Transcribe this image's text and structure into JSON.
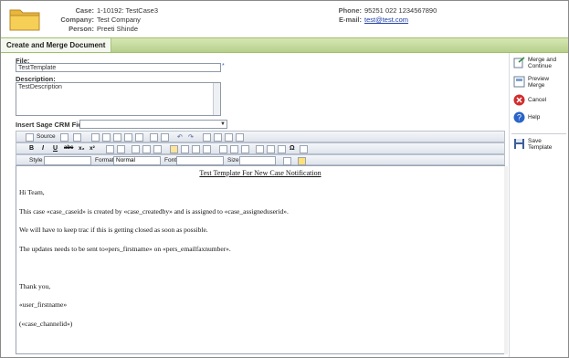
{
  "header": {
    "case_label": "Case:",
    "case_value": "1-10192: TestCase3",
    "company_label": "Company:",
    "company_value": "Test Company",
    "person_label": "Person:",
    "person_value": "Preeti Shinde",
    "phone_label": "Phone:",
    "phone_value": "95251 022 1234567890",
    "email_label": "E-mail:",
    "email_value": "test@test.com"
  },
  "tab": {
    "title": "Create and Merge Document"
  },
  "form": {
    "file_label": "File:",
    "file_value": "TestTemplate",
    "description_label": "Description:",
    "description_value": "TestDescription",
    "insert_field_label": "Insert Sage CRM Field",
    "insert_field_value": ""
  },
  "toolbar": {
    "source_label": "Source",
    "style_label": "Style",
    "format_label": "Format",
    "format_value": "Normal",
    "font_label": "Font",
    "size_label": "Size",
    "bold": "B",
    "italic": "I",
    "underline": "U",
    "strike": "abc",
    "subscript": "x₂",
    "superscript": "x²",
    "omega": "Ω"
  },
  "actions": {
    "merge_continue": "Merge and Continue",
    "preview_merge": "Preview Merge",
    "cancel": "Cancel",
    "help": "Help",
    "save_template": "Save Template"
  },
  "document": {
    "title": "Test Template For New Case Notification",
    "lines": [
      "Hi Team,",
      "This case «case_caseid» is created by «case_createdby» and is assigned to «case_assigneduserid».",
      "We will have to keep trac if this is getting closed as soon as possible.",
      "The updates needs to be sent to«pers_firstname» on «pers_emailfaxnumber».",
      "Thank you,",
      "«user_firstname»",
      "(«case_channelid»)"
    ]
  },
  "colors": {
    "tab_band": "#b6d08b",
    "link": "#1f3fa8",
    "cancel_red": "#d22d2d",
    "help_blue": "#2a64c8"
  }
}
